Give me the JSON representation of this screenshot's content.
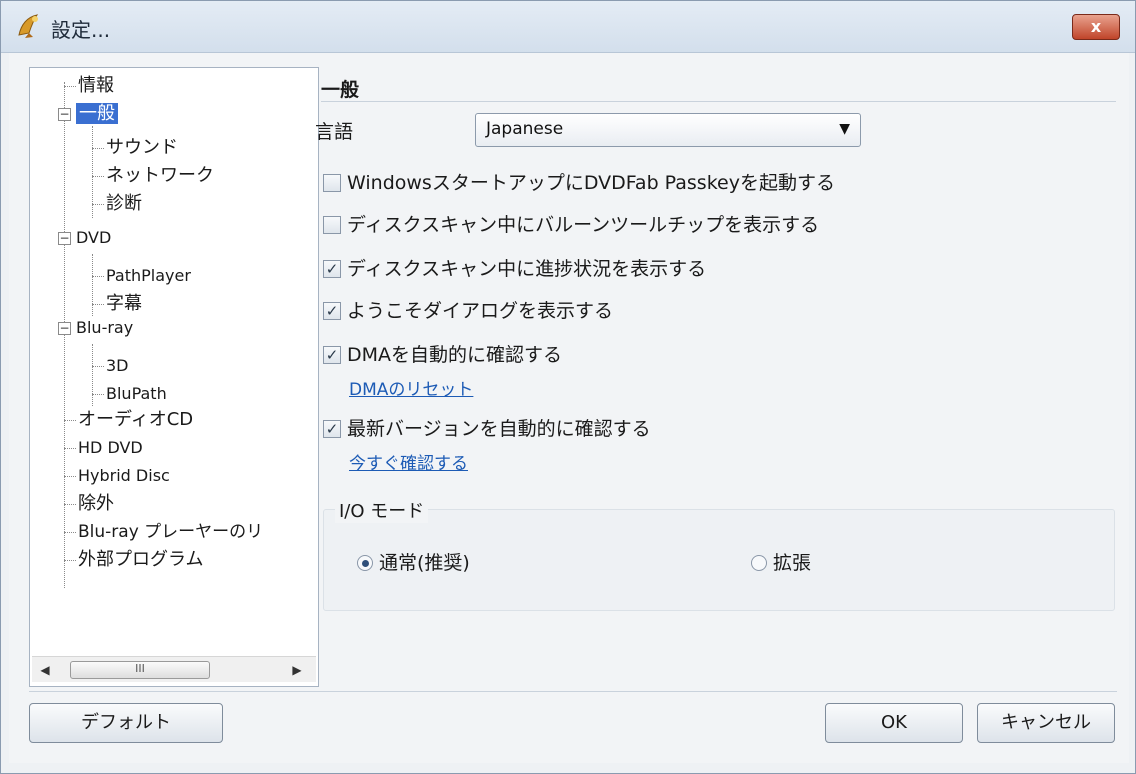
{
  "window": {
    "title": "設定...",
    "close_glyph": "x"
  },
  "tree": {
    "items": [
      {
        "label": "情報"
      },
      {
        "label": "一般"
      },
      {
        "label": "サウンド"
      },
      {
        "label": "ネットワーク"
      },
      {
        "label": "診断"
      },
      {
        "label": "DVD"
      },
      {
        "label": "PathPlayer"
      },
      {
        "label": "字幕"
      },
      {
        "label": "Blu-ray"
      },
      {
        "label": "3D"
      },
      {
        "label": "BluPath"
      },
      {
        "label": "オーディオCD"
      },
      {
        "label": "HD DVD"
      },
      {
        "label": "Hybrid Disc"
      },
      {
        "label": "除外"
      },
      {
        "label": "Blu-ray プレーヤーのリ"
      },
      {
        "label": "外部プログラム"
      }
    ],
    "selected": "一般",
    "scroll_thumb_grip": "III"
  },
  "general": {
    "section_title": "一般",
    "language_label": "言語",
    "language_value": "Japanese",
    "options": [
      {
        "label": "WindowsスタートアップにDVDFab Passkeyを起動する",
        "checked": false
      },
      {
        "label": "ディスクスキャン中にバルーンツールチップを表示する",
        "checked": false
      },
      {
        "label": "ディスクスキャン中に進捗状況を表示する",
        "checked": true
      },
      {
        "label": "ようこそダイアログを表示する",
        "checked": true
      },
      {
        "label": "DMAを自動的に確認する",
        "checked": true
      },
      {
        "label": "最新バージョンを自動的に確認する",
        "checked": true
      }
    ],
    "dma_reset_link": "DMAのリセット",
    "check_now_link": "今すぐ確認する",
    "io_mode": {
      "title": "I/O モード",
      "options": [
        {
          "label": "通常(推奨)",
          "checked": true
        },
        {
          "label": "拡張",
          "checked": false
        }
      ]
    }
  },
  "buttons": {
    "default": "デフォルト",
    "ok": "OK",
    "cancel": "キャンセル"
  }
}
